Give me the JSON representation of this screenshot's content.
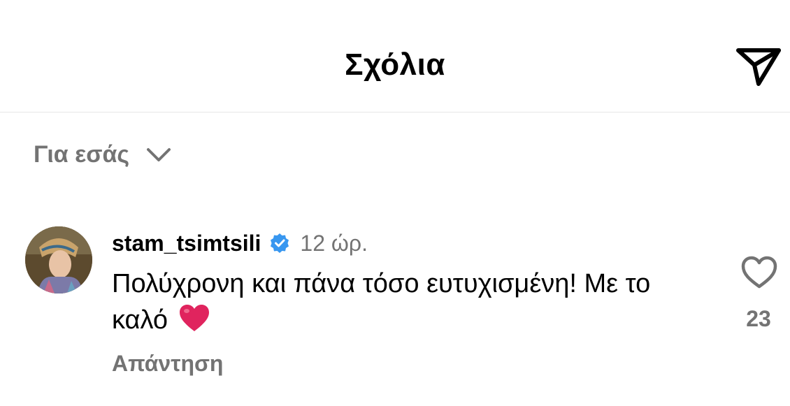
{
  "header": {
    "title": "Σχόλια",
    "share_icon": "paper-plane-icon"
  },
  "sort": {
    "label": "Για εσάς",
    "icon": "chevron-down-icon"
  },
  "comments": [
    {
      "username": "stam_tsimtsili",
      "verified": true,
      "timestamp": "12 ώρ.",
      "text": "Πολύχρονη και πάνα τόσο ευτυχισμένη! Με το καλό",
      "emoji": "heart-emoji",
      "reply_label": "Απάντηση",
      "like_icon": "heart-outline-icon",
      "like_count": "23"
    }
  ],
  "colors": {
    "text_primary": "#000000",
    "text_secondary": "#737373",
    "verified_blue": "#3897f0",
    "heart_red": "#e0245e",
    "divider": "#e6e6e6"
  }
}
